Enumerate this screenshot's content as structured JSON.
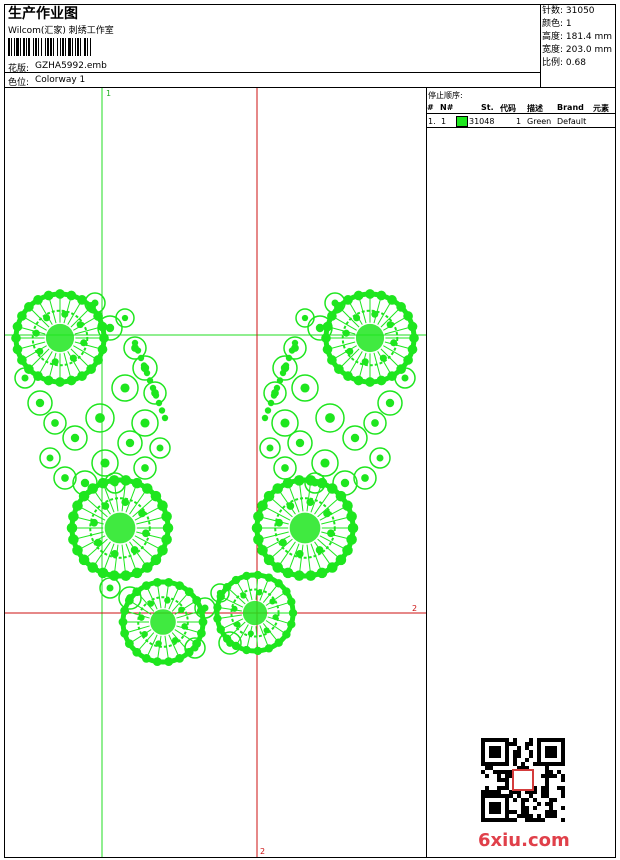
{
  "header": {
    "title": "生产作业图",
    "studio": "Wilcom(汇家) 刺绣工作室",
    "design_label": "花版:",
    "design_file": "GZHA5992.emb",
    "colorway_label": "色位:",
    "colorway": "Colorway 1"
  },
  "stats": {
    "stitches": "针数: 31050",
    "colors": "颜色: 1",
    "height": "高度: 181.4 mm",
    "width": "宽度: 203.0 mm",
    "scale": "比例: 0.68"
  },
  "legend": {
    "heading": "停止顺序:",
    "columns": [
      "#",
      "N#",
      "St.",
      "代码",
      "描述",
      "Brand",
      "元素"
    ],
    "rows": [
      {
        "index": "1.",
        "needle": "1",
        "stitches": "31048",
        "code": "1",
        "description": "Green",
        "brand": "Default",
        "swatch_color": "#1ee61e"
      }
    ]
  },
  "guides": {
    "v1_label": "1",
    "v2_label": "2",
    "h2_label": "2",
    "green": "#22dd22",
    "red": "#cc1111"
  },
  "colors": {
    "thread": "#1ee61e"
  },
  "branding": {
    "logo_text": "6xiu.com"
  }
}
